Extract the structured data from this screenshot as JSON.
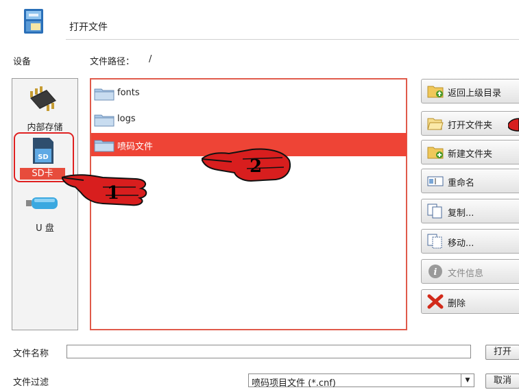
{
  "window": {
    "title": "打开文件"
  },
  "labels": {
    "devices": "设备",
    "path_label": "文件路径：",
    "path_value": "/"
  },
  "devices": [
    {
      "label": "内部存储",
      "icon": "chip-icon"
    },
    {
      "label": "SD卡",
      "icon": "sd-card-icon",
      "selected": true
    },
    {
      "label": "U 盘",
      "icon": "usb-drive-icon"
    }
  ],
  "files": [
    {
      "name": "fonts",
      "icon": "folder-icon"
    },
    {
      "name": "logs",
      "icon": "folder-icon"
    },
    {
      "name": "喷码文件",
      "icon": "folder-icon",
      "selected": true
    }
  ],
  "actions": [
    {
      "label": "返回上级目录",
      "icon": "folder-up-icon"
    },
    {
      "label": "打开文件夹",
      "icon": "folder-open-icon"
    },
    {
      "label": "新建文件夹",
      "icon": "folder-new-icon"
    },
    {
      "label": "重命名",
      "icon": "rename-icon"
    },
    {
      "label": "复制...",
      "icon": "copy-icon"
    },
    {
      "label": "移动...",
      "icon": "move-icon"
    },
    {
      "label": "文件信息",
      "icon": "info-icon",
      "disabled": true
    },
    {
      "label": "删除",
      "icon": "delete-icon"
    }
  ],
  "bottom": {
    "filename_label": "文件名称",
    "filename_value": "",
    "open_button": "打开",
    "filter_label": "文件过滤",
    "filter_value": "喷码项目文件 (*.cnf)",
    "cancel_button": "取消"
  },
  "annotations": [
    "1",
    "2"
  ],
  "colors": {
    "selection": "#ee4436",
    "highlight": "#e02020",
    "annotation_hand": "#d81e1e"
  }
}
